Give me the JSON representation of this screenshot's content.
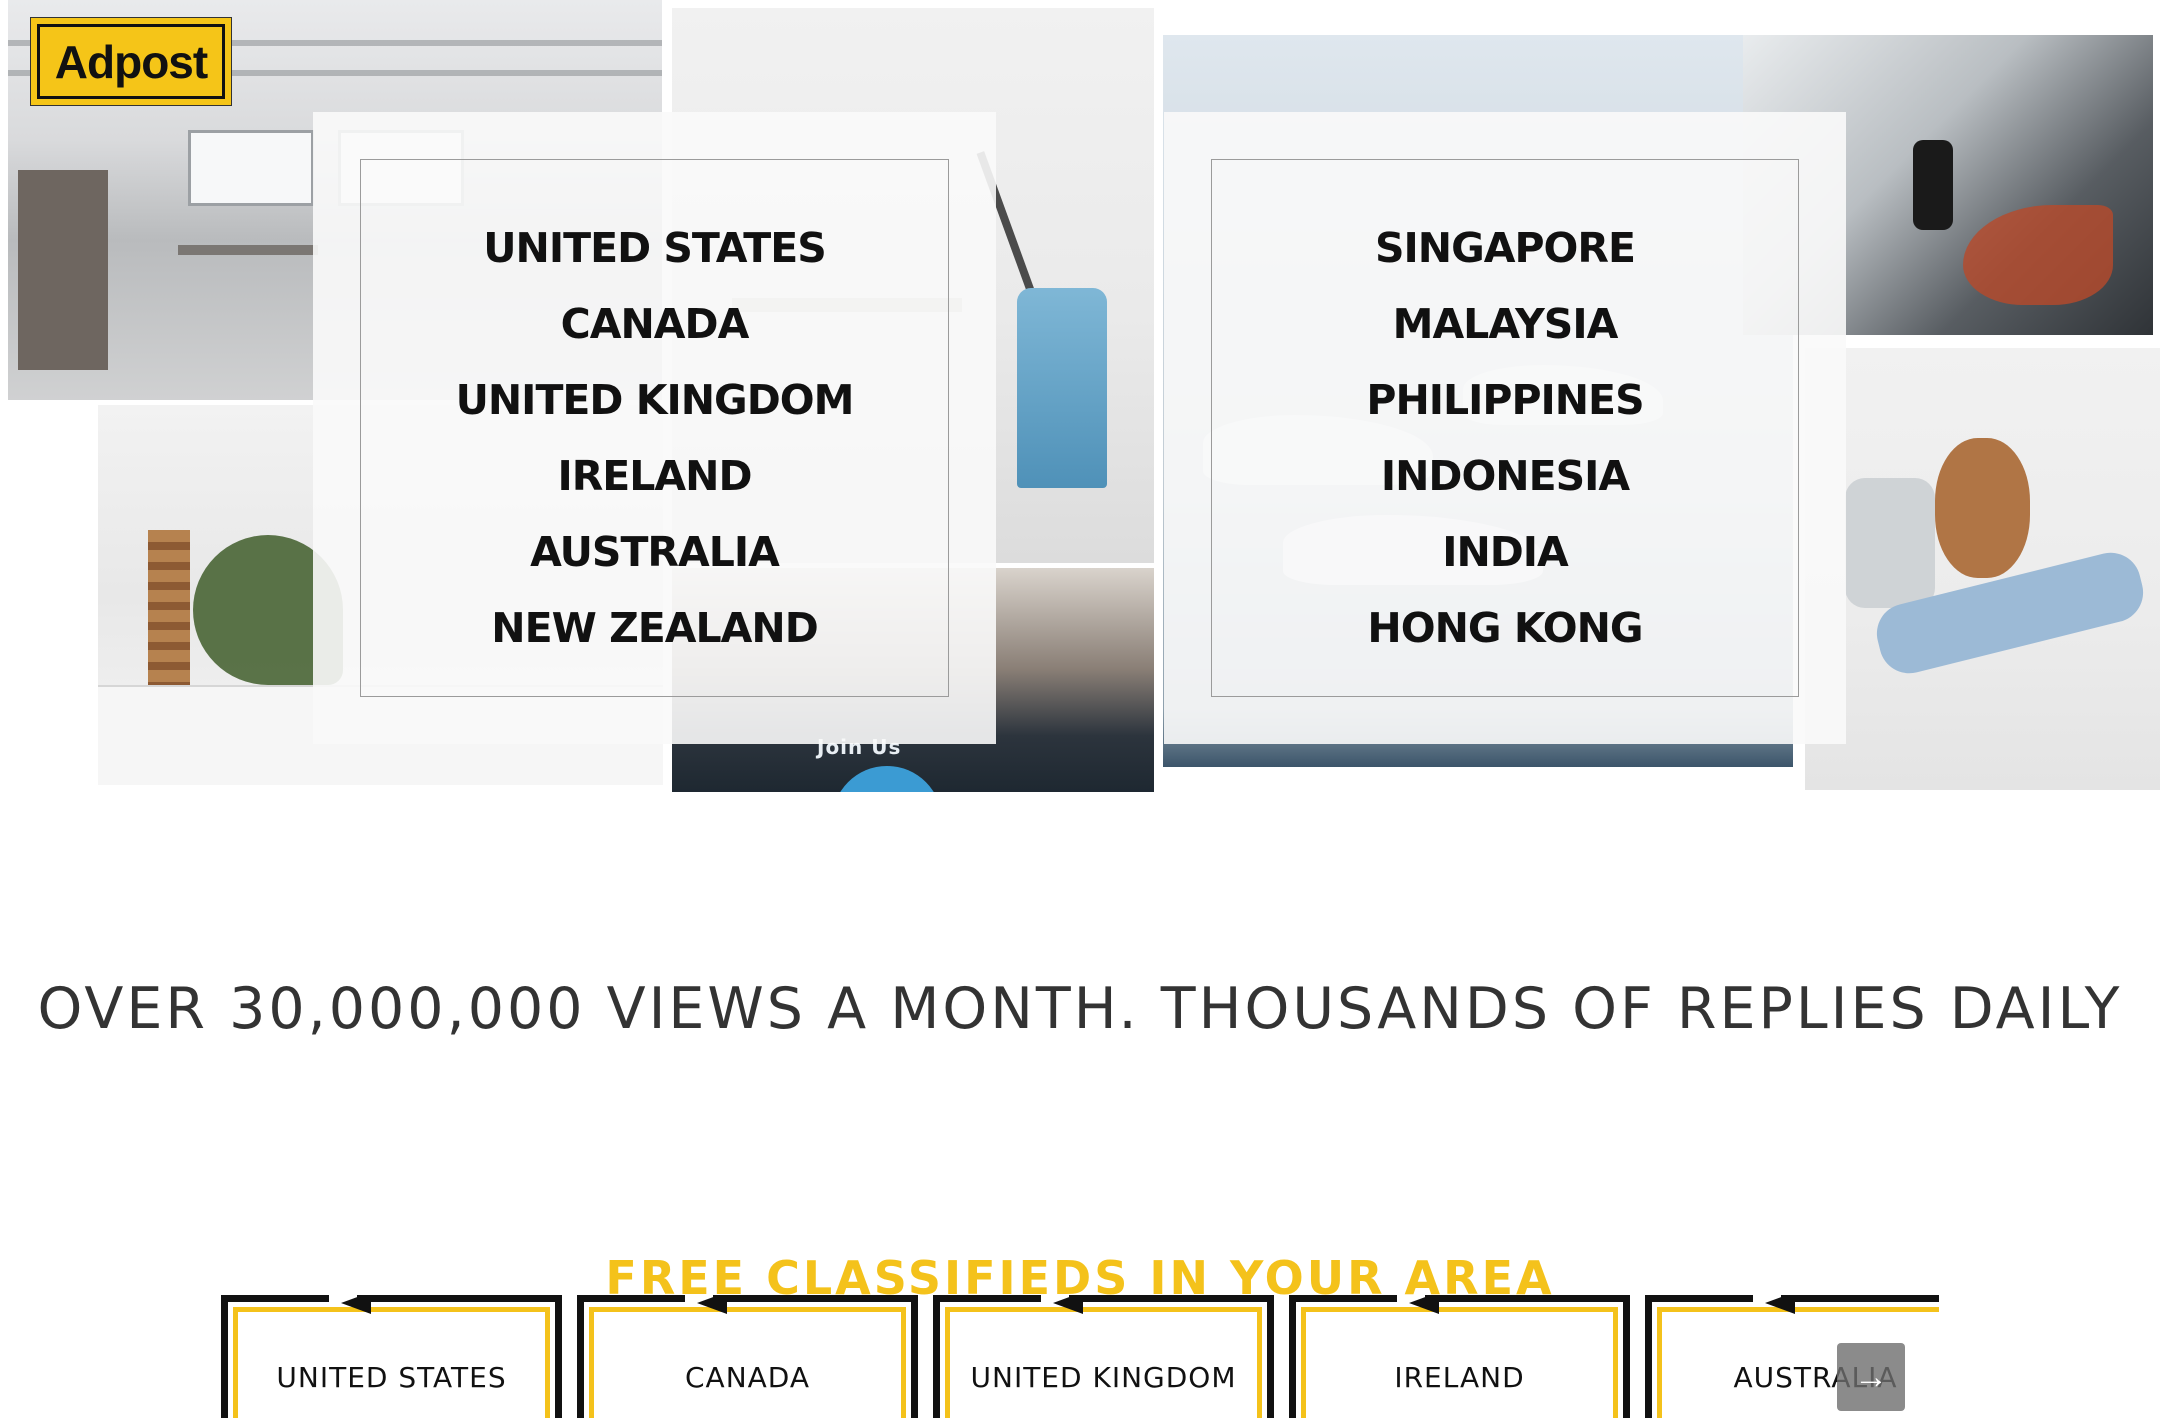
{
  "brand": {
    "logo_text": "Adpost"
  },
  "hero": {
    "left_countries": [
      "UNITED STATES",
      "CANADA",
      "UNITED KINGDOM",
      "IRELAND",
      "AUSTRALIA",
      "NEW ZEALAND"
    ],
    "right_countries": [
      "SINGAPORE",
      "MALAYSIA",
      "PHILIPPINES",
      "INDONESIA",
      "INDIA",
      "HONG KONG"
    ],
    "photo_caption": "Join Us"
  },
  "headline": "OVER 30,000,000 VIEWS A MONTH. THOUSANDS OF REPLIES DAILY",
  "area": {
    "title": "FREE CLASSIFIEDS IN YOUR AREA",
    "tiles": [
      "UNITED STATES",
      "CANADA",
      "UNITED KINGDOM",
      "IRELAND",
      "AUSTRALIA"
    ],
    "next_icon": "arrow-right-icon"
  },
  "colors": {
    "accent": "#f4c21b",
    "text": "#111111",
    "headline": "#333333"
  }
}
